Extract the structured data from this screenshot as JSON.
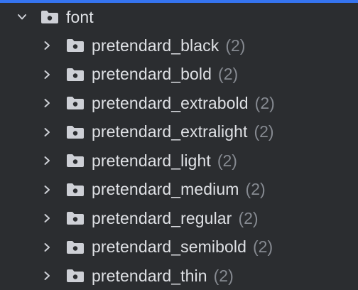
{
  "tree": {
    "root": {
      "label": "font",
      "expanded": true,
      "icon": "folder-icon"
    },
    "children": [
      {
        "label": "pretendard_black",
        "count": "(2)"
      },
      {
        "label": "pretendard_bold",
        "count": "(2)"
      },
      {
        "label": "pretendard_extrabold",
        "count": "(2)"
      },
      {
        "label": "pretendard_extralight",
        "count": "(2)"
      },
      {
        "label": "pretendard_light",
        "count": "(2)"
      },
      {
        "label": "pretendard_medium",
        "count": "(2)"
      },
      {
        "label": "pretendard_regular",
        "count": "(2)"
      },
      {
        "label": "pretendard_semibold",
        "count": "(2)"
      },
      {
        "label": "pretendard_thin",
        "count": "(2)"
      }
    ]
  },
  "colors": {
    "background": "#2b2d30",
    "accent": "#3574f0",
    "text": "#dfe1e5",
    "muted": "#868a91",
    "icon": "#ced0d6"
  }
}
